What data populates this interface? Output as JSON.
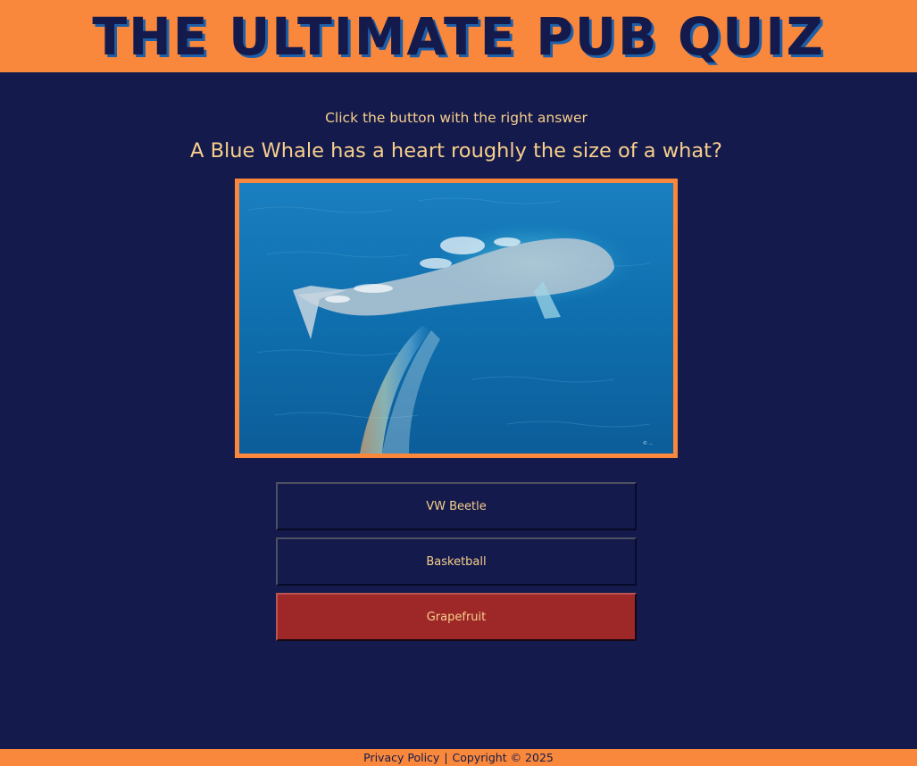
{
  "header": {
    "title": "THE ULTIMATE PUB QUIZ"
  },
  "quiz": {
    "instruction": "Click the button with the right answer",
    "question": "A Blue Whale has a heart roughly the size of a what?",
    "image": {
      "watermark": "© ..."
    },
    "answers": [
      {
        "label": "VW Beetle"
      },
      {
        "label": "Basketball"
      },
      {
        "label": "Grapefruit",
        "state": "incorrect-selected"
      }
    ]
  },
  "footer": {
    "privacy_label": "Privacy Policy",
    "separator": "|",
    "copyright": "Copyright © 2025"
  },
  "colors": {
    "background": "#141a4b",
    "accent_orange": "#f9883c",
    "text_cream": "#f7cf8d",
    "wrong_answer_red": "#9e2828"
  }
}
